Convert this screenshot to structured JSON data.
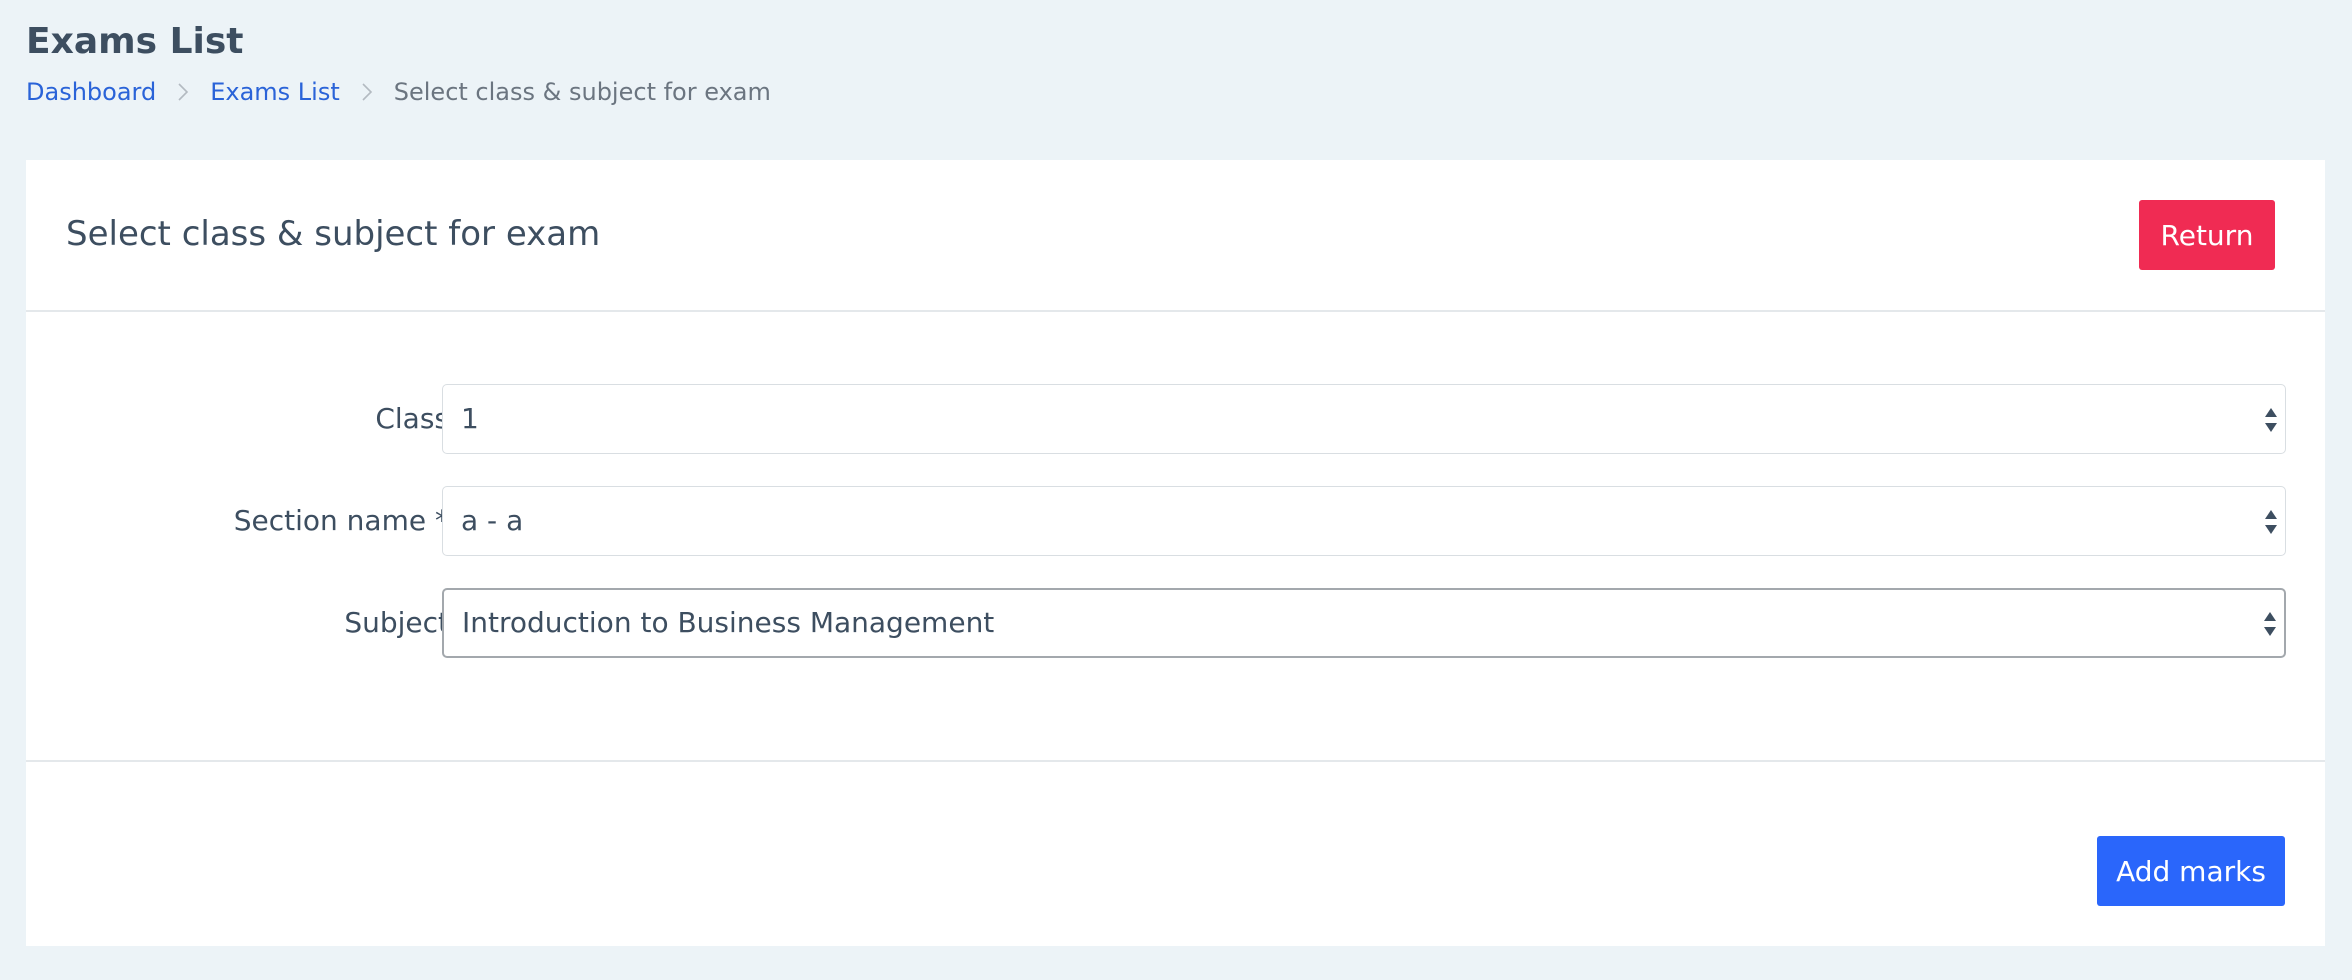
{
  "page": {
    "title": "Exams List"
  },
  "breadcrumb": {
    "items": [
      {
        "label": "Dashboard"
      },
      {
        "label": "Exams List"
      },
      {
        "label": "Select class & subject for exam"
      }
    ]
  },
  "card": {
    "title": "Select class & subject for exam",
    "return_label": "Return",
    "submit_label": "Add marks"
  },
  "form": {
    "class": {
      "label": "Class",
      "value": "1"
    },
    "section": {
      "label": "Section name *",
      "value": "a - a"
    },
    "subject": {
      "label": "Subject",
      "value": "Introduction to Business Management"
    }
  },
  "colors": {
    "page_background": "#ecf3f7",
    "link": "#2a63d8",
    "return_button": "#f02b53",
    "primary_button": "#2a66fb"
  },
  "icons": {
    "breadcrumb_separator": "chevron-right-icon",
    "select_arrows": "sort-arrows-icon"
  }
}
